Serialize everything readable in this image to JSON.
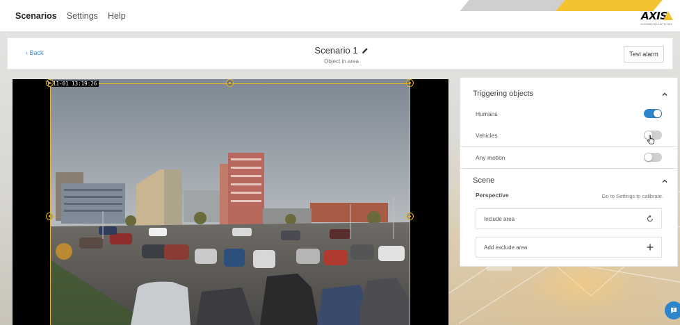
{
  "nav": {
    "items": [
      {
        "label": "Scenarios",
        "active": true
      },
      {
        "label": "Settings",
        "active": false
      },
      {
        "label": "Help",
        "active": false
      }
    ]
  },
  "brand": {
    "logo_text": "AXIS",
    "logo_subtext": "COMMUNICATIONS",
    "accent": "#f2c230"
  },
  "header": {
    "back_label": "‹ Back",
    "title": "Scenario 1",
    "subtitle": "Object in area",
    "test_alarm_label": "Test alarm"
  },
  "video": {
    "timestamp": "1-11-01 13:19:26",
    "area_color": "#e8b62a"
  },
  "panel": {
    "triggering": {
      "title": "Triggering objects",
      "options": [
        {
          "label": "Humans",
          "enabled": true
        },
        {
          "label": "Vehicles",
          "enabled": false
        }
      ]
    },
    "any_motion": {
      "label": "Any motion",
      "enabled": false
    },
    "scene": {
      "title": "Scene",
      "perspective_label": "Perspective",
      "calibrate_text": "Go to Settings to calibrate.",
      "include_area_label": "Include area",
      "add_exclude_label": "Add exclude area"
    }
  },
  "colors": {
    "toggle_on": "#2b86cd",
    "toggle_off": "#cfcfcf",
    "link": "#3b8dd4"
  },
  "icons": [
    "pencil-icon",
    "chevron-up-icon",
    "reset-icon",
    "plus-icon",
    "chat-icon",
    "hand-cursor-icon"
  ]
}
